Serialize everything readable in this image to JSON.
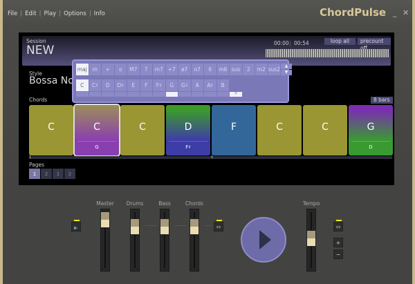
{
  "menu": [
    "File",
    "Edit",
    "Play",
    "Options",
    "Info"
  ],
  "app_title": "ChordPulse",
  "window_controls": {
    "minimize": "_",
    "close": "✕"
  },
  "session": {
    "label": "Session",
    "name": "NEW",
    "time_elapsed": "00:00",
    "time_total": "00:54",
    "loop": "loop all",
    "precount": "precount off"
  },
  "style": {
    "label": "Style",
    "name": "Bossa Nova"
  },
  "chord_popup": {
    "types": [
      "maj",
      "m",
      "+",
      "o",
      "M7",
      "7",
      "m7",
      "+7",
      "ø7",
      "o7",
      "6",
      "m6",
      "sus",
      "2",
      "m2",
      "sus2"
    ],
    "selected_type": "maj",
    "roots": [
      "C",
      "C♯",
      "D",
      "D♯",
      "E",
      "F",
      "F♯",
      "G",
      "G♯",
      "A",
      "A♯",
      "B"
    ],
    "selected_root": "C",
    "bass_icon": "𝄢",
    "spin_up": "▲",
    "spin_down": "▼"
  },
  "chords": {
    "label": "Chords",
    "bars": "8 bars",
    "items": [
      {
        "name": "C",
        "bass": "",
        "color": "#9a9634"
      },
      {
        "name": "C",
        "bass": "G",
        "color": "linear-gradient(#9c8e58,#8a3fb0 70%)"
      },
      {
        "name": "C",
        "bass": "",
        "color": "#9a9634"
      },
      {
        "name": "D",
        "bass": "F♯",
        "color": "linear-gradient(#3c9a2c 10%,#3d3da8 70%)"
      },
      {
        "name": "F",
        "bass": "",
        "color": "#33679a"
      },
      {
        "name": "C",
        "bass": "",
        "color": "#9a9634"
      },
      {
        "name": "C",
        "bass": "",
        "color": "#9a9634"
      },
      {
        "name": "G",
        "bass": "D",
        "color": "linear-gradient(#7a2fb0 10%,#3a9a32 70%)"
      }
    ],
    "ruler": [
      "1",
      "5"
    ]
  },
  "pages": {
    "label": "Pages",
    "items": [
      "1",
      "2",
      "1",
      "2"
    ],
    "active": 0
  },
  "mixer": {
    "faders": [
      {
        "label": "Master",
        "value": 0.95
      },
      {
        "label": "Drums",
        "value": 0.8
      },
      {
        "label": "Bass",
        "value": 0.8
      },
      {
        "label": "Chords",
        "value": 0.8
      }
    ],
    "tempo": {
      "label": "Tempo",
      "value": 0.55
    },
    "plus": "+",
    "minus": "−",
    "speaker_icon": "🔈",
    "link_icon": "⇔"
  }
}
